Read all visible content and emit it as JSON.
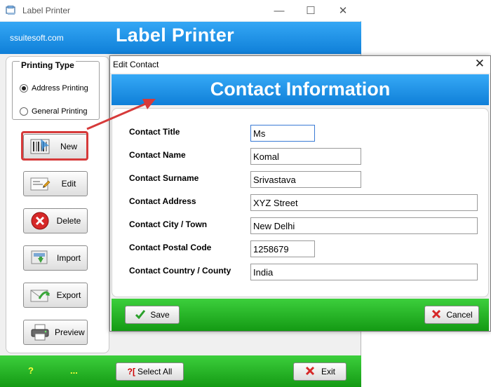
{
  "window": {
    "title": "Label Printer",
    "site": "ssuitesoft.com",
    "banner_title": "Label Printer",
    "minimize": "—",
    "maximize": "☐",
    "close": "✕"
  },
  "printing_type": {
    "legend": "Printing Type",
    "options": [
      {
        "label": "Address Printing",
        "selected": true
      },
      {
        "label": "General Printing",
        "selected": false
      }
    ]
  },
  "side_buttons": [
    {
      "label": "New",
      "icon": "new-icon"
    },
    {
      "label": "Edit",
      "icon": "edit-icon"
    },
    {
      "label": "Delete",
      "icon": "delete-icon"
    },
    {
      "label": "Import",
      "icon": "import-icon"
    },
    {
      "label": "Export",
      "icon": "export-icon"
    },
    {
      "label": "Preview",
      "icon": "printer-icon"
    }
  ],
  "footer": {
    "help": "?",
    "dots": "...",
    "select_all": "Select All",
    "select_all_prefix": "?[",
    "exit": "Exit"
  },
  "dialog": {
    "title": "Edit Contact",
    "close": "✕",
    "banner": "Contact Information",
    "fields": [
      {
        "label": "Contact Title",
        "value": "Ms"
      },
      {
        "label": "Contact Name",
        "value": "Komal"
      },
      {
        "label": "Contact Surname",
        "value": "Srivastava"
      },
      {
        "label": "Contact Address",
        "value": "XYZ Street"
      },
      {
        "label": "Contact City / Town",
        "value": "New Delhi"
      },
      {
        "label": "Contact Postal Code",
        "value": "1258679"
      },
      {
        "label": "Contact Country / County",
        "value": "India"
      }
    ],
    "save": "Save",
    "cancel": "Cancel"
  },
  "colors": {
    "banner_blue": "#1a8fe3",
    "footer_green": "#22b022",
    "highlight_red": "#d63a3a"
  }
}
